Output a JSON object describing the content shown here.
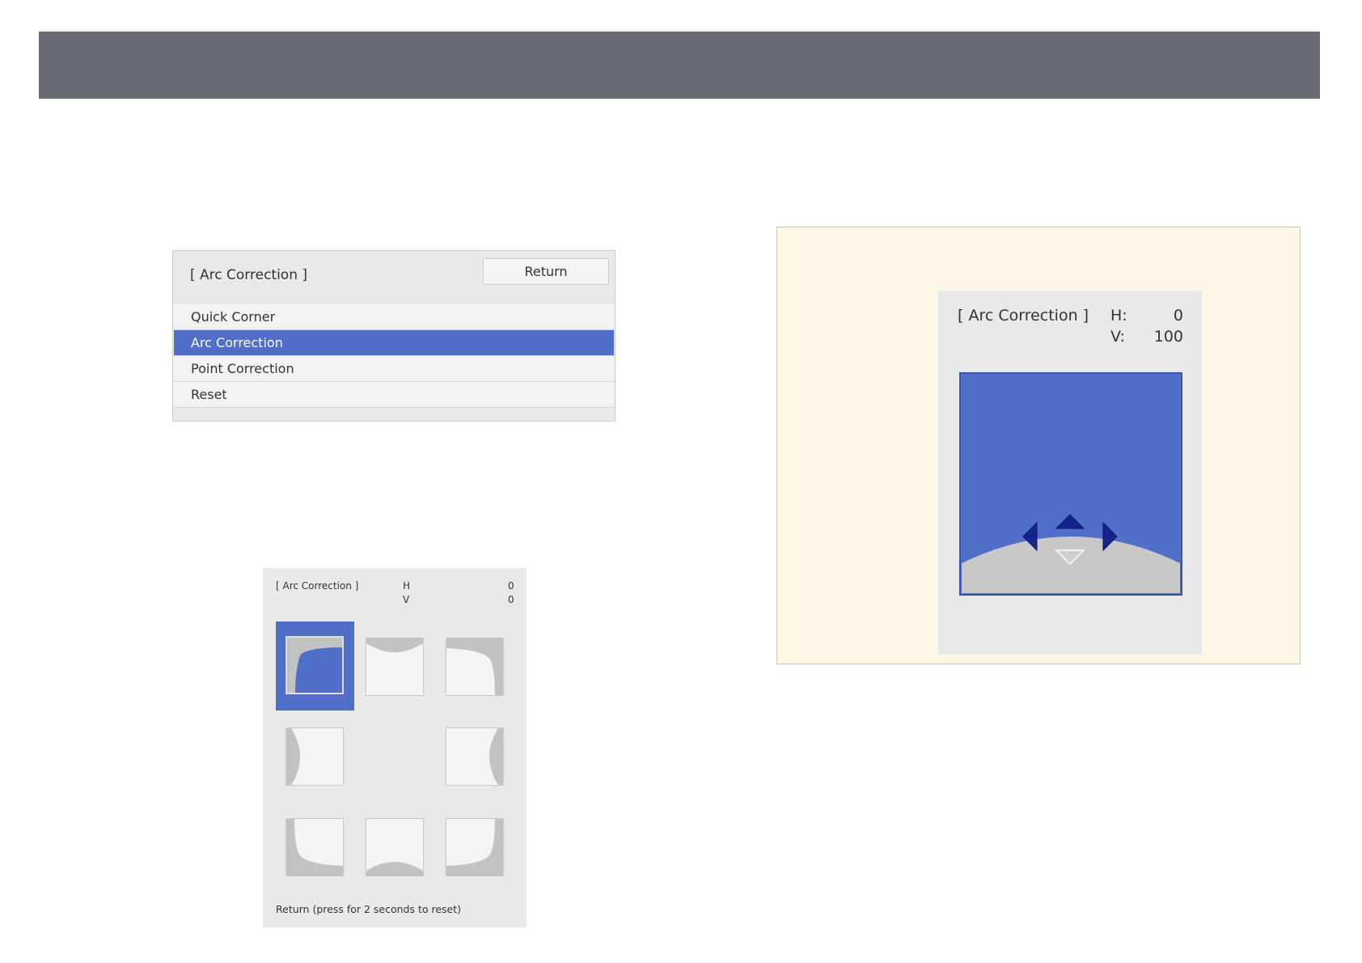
{
  "menu": {
    "title": "[ Arc Correction ]",
    "return_label": "Return",
    "items": [
      {
        "label": "Quick Corner",
        "selected": false
      },
      {
        "label": "Arc Correction",
        "selected": true
      },
      {
        "label": "Point Correction",
        "selected": false
      },
      {
        "label": "Reset",
        "selected": false
      }
    ]
  },
  "arc_panel": {
    "title": "[ Arc Correction ]",
    "h_label": "H",
    "v_label": "V",
    "h_value": "0",
    "v_value": "0",
    "footer": "Return (press for 2 seconds to reset)"
  },
  "preview_panel": {
    "title": "[ Arc Correction ]",
    "h_label": "H:",
    "v_label": "V:",
    "h_value": "0",
    "v_value": "100"
  },
  "colors": {
    "accent": "#4f6fc9",
    "header_bar": "#686b73",
    "panel_bg": "#e9e9e9",
    "frame_bg": "#fdf7e6",
    "arrow": "#17238f"
  },
  "icons": [
    "arrow-up-icon",
    "arrow-down-icon",
    "arrow-left-icon",
    "arrow-right-icon"
  ]
}
